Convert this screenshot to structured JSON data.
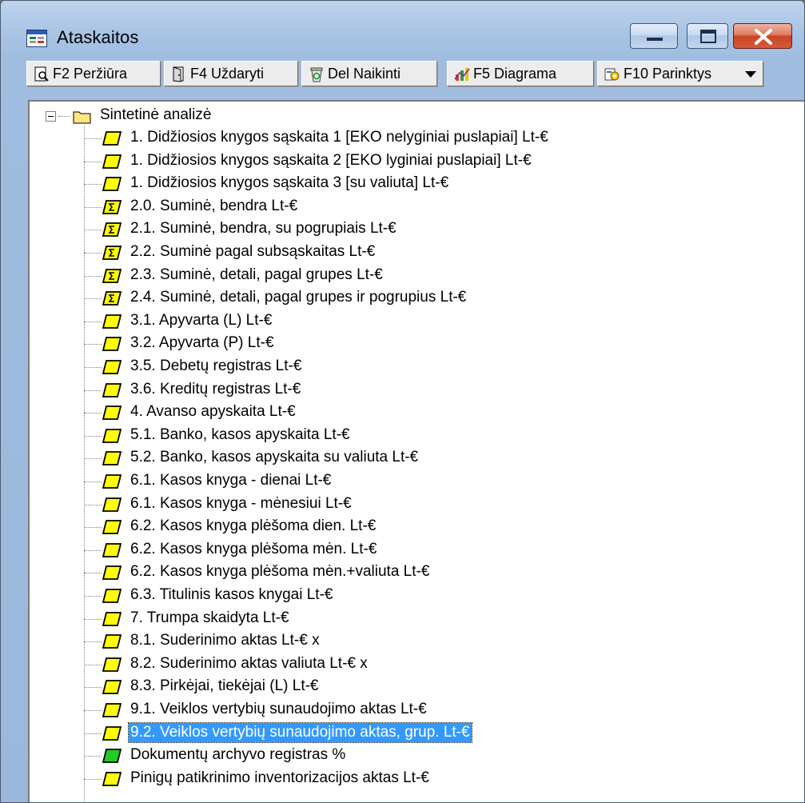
{
  "window": {
    "title": "Ataskaitos"
  },
  "toolbar": {
    "buttons": [
      {
        "label": "F2 Peržiūra",
        "icon": "preview-icon"
      },
      {
        "label": "F4 Uždaryti",
        "icon": "close-door-icon"
      },
      {
        "label": "Del Naikinti",
        "icon": "recycle-icon"
      },
      {
        "label": "F5 Diagrama",
        "icon": "chart-icon"
      },
      {
        "label": "F10 Parinktys",
        "icon": "settings-icon"
      }
    ]
  },
  "tree": {
    "root": "Sintetinė analizė",
    "items": [
      {
        "label": "1. Didžiosios knygos sąskaita 1 [EKO nelyginiai puslapiai] Lt-€",
        "icon": "report-yellow"
      },
      {
        "label": "1. Didžiosios knygos sąskaita 2 [EKO lyginiai puslapiai] Lt-€",
        "icon": "report-yellow"
      },
      {
        "label": "1. Didžiosios knygos sąskaita 3 [su valiuta] Lt-€",
        "icon": "report-yellow"
      },
      {
        "label": "2.0. Suminė, bendra Lt-€",
        "icon": "report-sum"
      },
      {
        "label": "2.1. Suminė, bendra, su pogrupiais Lt-€",
        "icon": "report-sum"
      },
      {
        "label": "2.2. Suminė pagal subsąskaitas Lt-€",
        "icon": "report-sum"
      },
      {
        "label": "2.3. Suminė, detali, pagal grupes Lt-€",
        "icon": "report-sum"
      },
      {
        "label": "2.4. Suminė, detali, pagal grupes ir pogrupius Lt-€",
        "icon": "report-sum"
      },
      {
        "label": "3.1. Apyvarta  (L) Lt-€",
        "icon": "report-yellow"
      },
      {
        "label": "3.2. Apyvarta  (P) Lt-€",
        "icon": "report-yellow"
      },
      {
        "label": "3.5. Debetų registras Lt-€",
        "icon": "report-yellow"
      },
      {
        "label": "3.6. Kreditų registras Lt-€",
        "icon": "report-yellow"
      },
      {
        "label": "4. Avanso apyskaita Lt-€",
        "icon": "report-yellow"
      },
      {
        "label": "5.1. Banko, kasos apyskaita Lt-€",
        "icon": "report-yellow"
      },
      {
        "label": "5.2. Banko, kasos apyskaita su valiuta Lt-€",
        "icon": "report-yellow"
      },
      {
        "label": "6.1. Kasos knyga - dienai Lt-€",
        "icon": "report-yellow"
      },
      {
        "label": "6.1. Kasos knyga - mėnesiui Lt-€",
        "icon": "report-yellow"
      },
      {
        "label": "6.2. Kasos knyga plėšoma dien. Lt-€",
        "icon": "report-yellow"
      },
      {
        "label": "6.2. Kasos knyga plėšoma mėn. Lt-€",
        "icon": "report-yellow"
      },
      {
        "label": "6.2. Kasos knyga plėšoma mėn.+valiuta Lt-€",
        "icon": "report-yellow"
      },
      {
        "label": "6.3. Titulinis kasos knygai Lt-€",
        "icon": "report-yellow"
      },
      {
        "label": "7. Trumpa skaidyta Lt-€",
        "icon": "report-yellow"
      },
      {
        "label": "8.1. Suderinimo aktas Lt-€ x",
        "icon": "report-yellow"
      },
      {
        "label": "8.2. Suderinimo aktas valiuta Lt-€ x",
        "icon": "report-yellow"
      },
      {
        "label": "8.3. Pirkėjai, tiekėjai (L) Lt-€",
        "icon": "report-yellow"
      },
      {
        "label": "9.1. Veiklos vertybių sunaudojimo aktas Lt-€",
        "icon": "report-yellow"
      },
      {
        "label": "9.2. Veiklos vertybių sunaudojimo aktas, grup. Lt-€",
        "icon": "report-yellow",
        "selected": true
      },
      {
        "label": "Dokumentų archyvo registras %",
        "icon": "report-green"
      },
      {
        "label": "Pinigų patikrinimo inventorizacijos aktas Lt-€",
        "icon": "report-yellow"
      }
    ]
  },
  "colors": {
    "selection": "#3399ff",
    "report_yellow": "#ffff00",
    "report_green": "#22cc22",
    "folder": "#ffe680"
  }
}
